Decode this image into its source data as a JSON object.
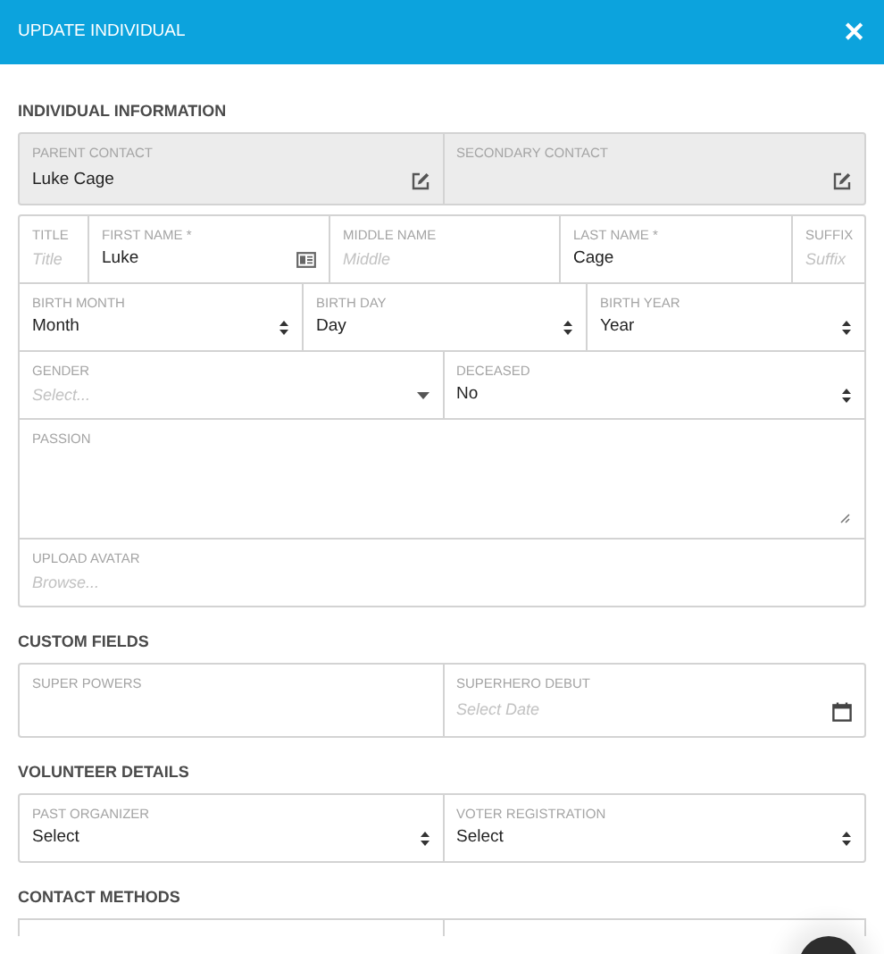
{
  "header": {
    "title": "UPDATE INDIVIDUAL",
    "close": "✕"
  },
  "sections": [
    {
      "title": "INDIVIDUAL INFORMATION",
      "boxes": [
        {
          "readonly": true,
          "rows": [
            {
              "fields": [
                {
                  "kind": "contact",
                  "label": "PARENT CONTACT",
                  "value": "Luke Cage"
                },
                {
                  "kind": "contact",
                  "label": "SECONDARY CONTACT"
                }
              ]
            }
          ]
        },
        {
          "readonly": false,
          "rows": [
            {
              "fields": [
                {
                  "kind": "text",
                  "label": "TITLE",
                  "placeholder": "Title"
                },
                {
                  "kind": "card",
                  "label": "FIRST NAME *",
                  "value": "Luke"
                },
                {
                  "kind": "text",
                  "label": "MIDDLE NAME",
                  "placeholder": "Middle"
                },
                {
                  "kind": "text",
                  "label": "LAST NAME *",
                  "value": "Cage"
                },
                {
                  "kind": "text",
                  "label": "SUFFIX",
                  "placeholder": "Suffix"
                }
              ]
            },
            {
              "fields": [
                {
                  "kind": "native-select",
                  "label": "BIRTH MONTH",
                  "value": "Month"
                },
                {
                  "kind": "native-select",
                  "label": "BIRTH DAY",
                  "value": "Day"
                },
                {
                  "kind": "native-select",
                  "label": "BIRTH YEAR",
                  "value": "Year"
                }
              ]
            },
            {
              "fields": [
                {
                  "kind": "select",
                  "label": "GENDER",
                  "placeholder": "Select..."
                },
                {
                  "kind": "native-select",
                  "label": "DECEASED",
                  "value": "No"
                }
              ]
            },
            {
              "fields": [
                {
                  "kind": "textarea",
                  "label": "PASSION"
                }
              ]
            },
            {
              "fields": [
                {
                  "kind": "file",
                  "label": "UPLOAD AVATAR",
                  "placeholder": "Browse..."
                }
              ]
            }
          ]
        }
      ]
    },
    {
      "title": "CUSTOM FIELDS",
      "boxes": [
        {
          "readonly": false,
          "rows": [
            {
              "fields": [
                {
                  "kind": "text",
                  "label": "SUPER POWERS"
                },
                {
                  "kind": "date",
                  "label": "SUPERHERO DEBUT",
                  "placeholder": "Select Date"
                }
              ]
            }
          ]
        }
      ]
    },
    {
      "title": "VOLUNTEER DETAILS",
      "boxes": [
        {
          "readonly": false,
          "rows": [
            {
              "fields": [
                {
                  "kind": "native-select",
                  "label": "PAST ORGANIZER",
                  "value": "Select"
                },
                {
                  "kind": "native-select",
                  "label": "VOTER REGISTRATION",
                  "value": "Select"
                }
              ]
            }
          ]
        }
      ]
    },
    {
      "title": "CONTACT METHODS"
    }
  ]
}
